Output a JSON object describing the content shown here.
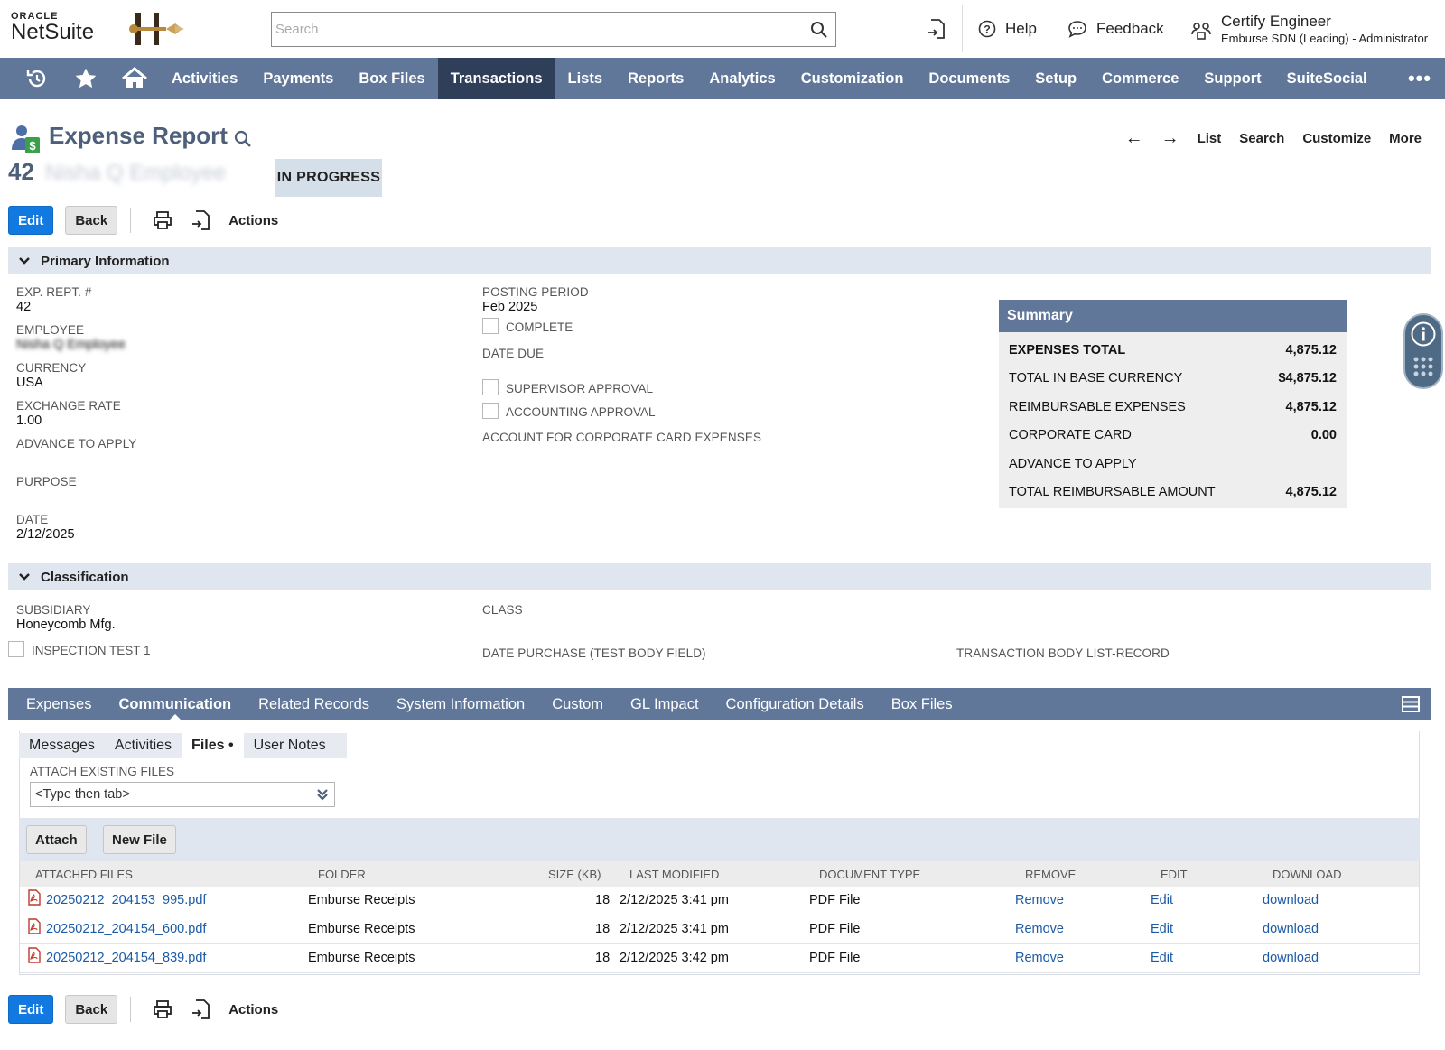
{
  "brand": {
    "oracle": "ORACLE",
    "product": "NetSuite"
  },
  "search": {
    "placeholder": "Search"
  },
  "top_actions": {
    "help": "Help",
    "feedback": "Feedback"
  },
  "user": {
    "name": "Certify Engineer",
    "role": "Emburse SDN (Leading) - Administrator"
  },
  "nav": {
    "items": [
      "Activities",
      "Payments",
      "Box Files",
      "Transactions",
      "Lists",
      "Reports",
      "Analytics",
      "Customization",
      "Documents",
      "Setup",
      "Commerce",
      "Support",
      "SuiteSocial"
    ],
    "active": "Transactions",
    "more": "•••"
  },
  "page": {
    "title": "Expense Report",
    "record_number": "42",
    "record_name": "Nisha Q Employee",
    "status": "IN PROGRESS",
    "nav_links": {
      "list": "List",
      "search": "Search",
      "customize": "Customize",
      "more": "More"
    }
  },
  "buttons": {
    "edit": "Edit",
    "back": "Back",
    "actions": "Actions"
  },
  "primary": {
    "header": "Primary Information",
    "exp_rept_label": "EXP. REPT. #",
    "exp_rept_value": "42",
    "employee_label": "EMPLOYEE",
    "employee_value": "Nisha Q Employee",
    "currency_label": "CURRENCY",
    "currency_value": "USA",
    "exchange_rate_label": "EXCHANGE RATE",
    "exchange_rate_value": "1.00",
    "advance_label": "ADVANCE TO APPLY",
    "purpose_label": "PURPOSE",
    "date_label": "DATE",
    "date_value": "2/12/2025",
    "posting_period_label": "POSTING PERIOD",
    "posting_period_value": "Feb 2025",
    "complete_label": "COMPLETE",
    "date_due_label": "DATE DUE",
    "supervisor_approval_label": "SUPERVISOR APPROVAL",
    "accounting_approval_label": "ACCOUNTING APPROVAL",
    "corp_card_account_label": "ACCOUNT FOR CORPORATE CARD EXPENSES"
  },
  "summary": {
    "header": "Summary",
    "rows": [
      {
        "label": "EXPENSES TOTAL",
        "value": "4,875.12"
      },
      {
        "label": "TOTAL IN BASE CURRENCY",
        "value": "$4,875.12"
      },
      {
        "label": "REIMBURSABLE EXPENSES",
        "value": "4,875.12"
      },
      {
        "label": "CORPORATE CARD",
        "value": "0.00"
      },
      {
        "label": "ADVANCE TO APPLY",
        "value": ""
      },
      {
        "label": "TOTAL REIMBURSABLE AMOUNT",
        "value": "4,875.12"
      }
    ]
  },
  "classification": {
    "header": "Classification",
    "subsidiary_label": "SUBSIDIARY",
    "subsidiary_value": "Honeycomb Mfg.",
    "class_label": "CLASS",
    "inspection_label": "INSPECTION TEST 1",
    "date_purchase_label": "DATE PURCHASE (TEST BODY FIELD)",
    "list_record_label": "TRANSACTION BODY LIST-RECORD"
  },
  "subtabs": {
    "items": [
      "Expenses",
      "Communication",
      "Related Records",
      "System Information",
      "Custom",
      "GL Impact",
      "Configuration Details",
      "Box Files"
    ],
    "active": "Communication"
  },
  "inner_tabs": {
    "items": [
      "Messages",
      "Activities",
      "Files •",
      "User Notes"
    ],
    "active": "Files •"
  },
  "files": {
    "attach_label": "ATTACH EXISTING FILES",
    "attach_placeholder": "<Type then tab>",
    "attach_button": "Attach",
    "new_file_button": "New File",
    "columns": [
      "ATTACHED FILES",
      "FOLDER",
      "SIZE (KB)",
      "LAST MODIFIED",
      "DOCUMENT TYPE",
      "REMOVE",
      "EDIT",
      "DOWNLOAD"
    ],
    "rows": [
      {
        "name": "20250212_204153_995.pdf",
        "folder": "Emburse Receipts",
        "size": "18",
        "modified": "2/12/2025 3:41 pm",
        "type": "PDF File",
        "remove": "Remove",
        "edit": "Edit",
        "download": "download"
      },
      {
        "name": "20250212_204154_600.pdf",
        "folder": "Emburse Receipts",
        "size": "18",
        "modified": "2/12/2025 3:41 pm",
        "type": "PDF File",
        "remove": "Remove",
        "edit": "Edit",
        "download": "download"
      },
      {
        "name": "20250212_204154_839.pdf",
        "folder": "Emburse Receipts",
        "size": "18",
        "modified": "2/12/2025 3:42 pm",
        "type": "PDF File",
        "remove": "Remove",
        "edit": "Edit",
        "download": "download"
      }
    ]
  },
  "colors": {
    "nav": "#607799",
    "nav_active": "#2f3f59",
    "primary_button": "#1279e0",
    "section_header": "#e0e6ef",
    "link": "#1a5aa6"
  }
}
